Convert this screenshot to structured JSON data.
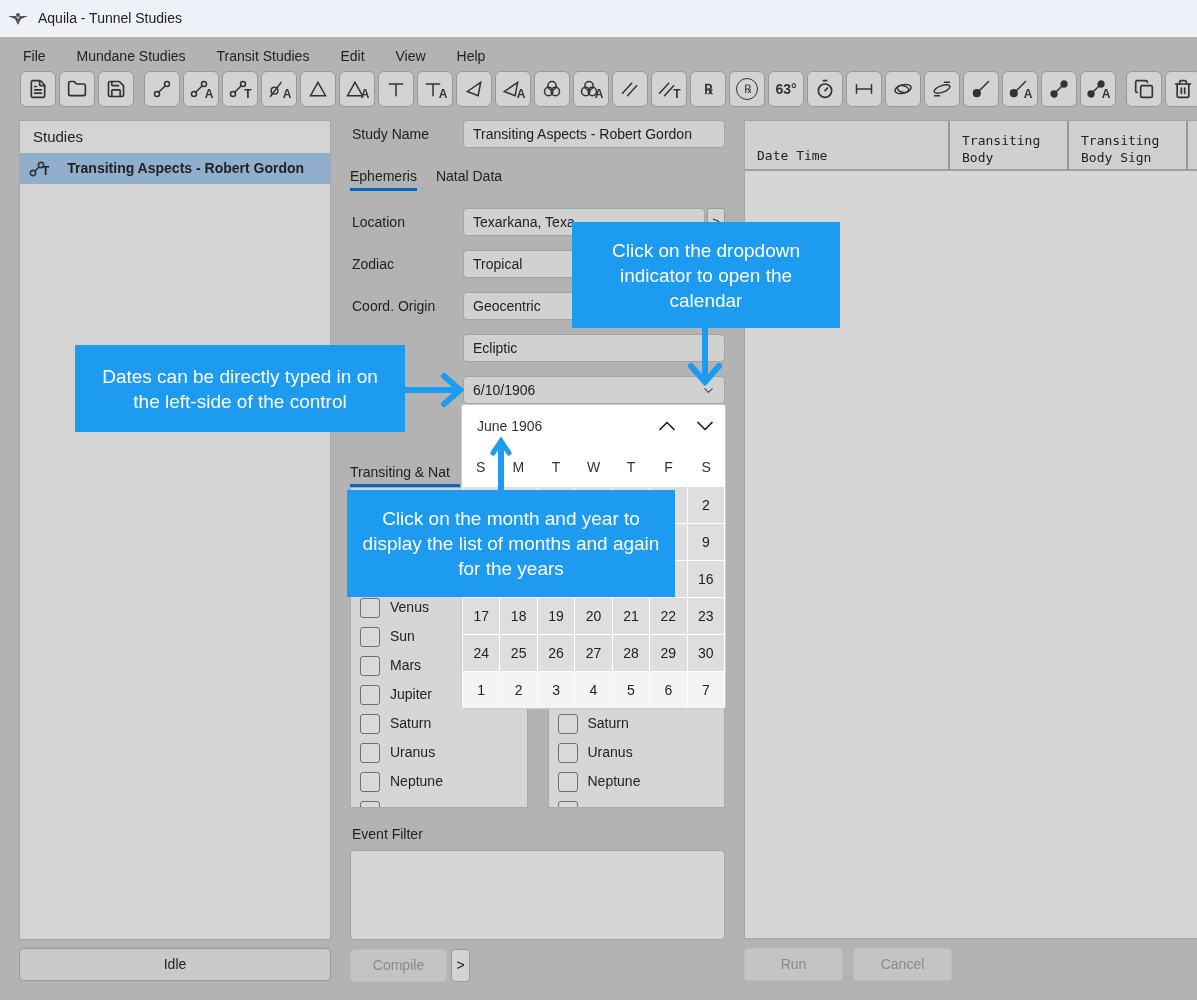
{
  "window": {
    "title": "Aquila - Tunnel Studies"
  },
  "menu": [
    "File",
    "Mundane Studies",
    "Transit Studies",
    "Edit",
    "View",
    "Help"
  ],
  "toolbar": [
    {
      "kind": "document"
    },
    {
      "kind": "folder"
    },
    {
      "kind": "save"
    },
    {
      "kind": "link"
    },
    {
      "kind": "link",
      "letter": "A"
    },
    {
      "kind": "link",
      "letter": "T"
    },
    {
      "kind": "slashed",
      "letter": "A"
    },
    {
      "kind": "triangle"
    },
    {
      "kind": "triangle",
      "letter": "A"
    },
    {
      "kind": "tee"
    },
    {
      "kind": "tee",
      "letter": "A"
    },
    {
      "kind": "angle"
    },
    {
      "kind": "angle",
      "letter": "A"
    },
    {
      "kind": "venn"
    },
    {
      "kind": "venn",
      "letter": "A"
    },
    {
      "kind": "parallel"
    },
    {
      "kind": "parallel",
      "letter": "T"
    },
    {
      "kind": "glyph",
      "text": "℞"
    },
    {
      "kind": "circled",
      "text": "℞"
    },
    {
      "kind": "glyph",
      "text": "63°"
    },
    {
      "kind": "timer"
    },
    {
      "kind": "span"
    },
    {
      "kind": "orbit"
    },
    {
      "kind": "ellipse"
    },
    {
      "kind": "dotline"
    },
    {
      "kind": "dotline",
      "letter": "A"
    },
    {
      "kind": "dumbbell"
    },
    {
      "kind": "dumbbell",
      "letter": "A"
    },
    {
      "kind": "copy"
    },
    {
      "kind": "trash"
    }
  ],
  "sidebar": {
    "title": "Studies",
    "items": [
      {
        "label": "Transiting Aspects - Robert Gordon",
        "icon_letter": "T",
        "selected": true
      }
    ]
  },
  "status": {
    "label": "Idle"
  },
  "form": {
    "study_name": {
      "label": "Study Name",
      "value": "Transiting Aspects - Robert Gordon"
    },
    "tabs": [
      {
        "label": "Ephemeris",
        "selected": true
      },
      {
        "label": "Natal Data",
        "selected": false
      }
    ],
    "fields": [
      {
        "label": "Location",
        "value": "Texarkana, Texa",
        "kind": "combo",
        "side_button": ">"
      },
      {
        "label": "Zodiac",
        "value": "Tropical",
        "kind": "select"
      },
      {
        "label": "Coord. Origin",
        "value": "Geocentric",
        "kind": "select"
      },
      {
        "value": "Ecliptic",
        "kind": "select"
      },
      {
        "value": "6/10/1906",
        "kind": "date"
      }
    ],
    "subtab": {
      "label": "Transiting & Nat",
      "selected": true
    },
    "transiting": [
      {
        "label": "Venus",
        "checked": false
      },
      {
        "label": "Sun",
        "checked": false
      },
      {
        "label": "Mars",
        "checked": false
      },
      {
        "label": "Jupiter",
        "checked": false
      },
      {
        "label": "Saturn",
        "checked": false
      },
      {
        "label": "Uranus",
        "checked": false
      },
      {
        "label": "Neptune",
        "checked": false
      },
      {
        "checked": false
      }
    ],
    "natal": [
      {
        "label": "Saturn",
        "checked": false
      },
      {
        "label": "Uranus",
        "checked": false
      },
      {
        "label": "Neptune",
        "checked": false
      },
      {
        "checked": false
      }
    ],
    "event_filter": {
      "label": "Event Filter"
    },
    "compile": {
      "label": "Compile",
      "disabled": true
    },
    "compile_more": {
      "label": ">",
      "disabled": false
    }
  },
  "calendar": {
    "month": "June 1906",
    "weekdays": [
      "S",
      "M",
      "T",
      "W",
      "T",
      "F",
      "S"
    ],
    "weeks": [
      {
        "outside": false,
        "days": [
          "2"
        ]
      },
      {
        "outside": false,
        "days": [
          "9"
        ]
      },
      {
        "outside": false,
        "days": [
          "16"
        ]
      },
      {
        "outside": false,
        "days": [
          "17",
          "18",
          "19",
          "20",
          "21",
          "22",
          "23"
        ]
      },
      {
        "outside": false,
        "days": [
          "24",
          "25",
          "26",
          "27",
          "28",
          "29",
          "30"
        ]
      },
      {
        "outside": true,
        "days": [
          "1",
          "2",
          "3",
          "4",
          "5",
          "6",
          "7"
        ]
      }
    ]
  },
  "table": {
    "columns": [
      "Date Time",
      "Transiting Body",
      "Transiting Body Sign"
    ]
  },
  "actions": [
    {
      "label": "Run",
      "disabled": true
    },
    {
      "label": "Cancel",
      "disabled": true
    }
  ],
  "callouts": [
    {
      "text": "Dates can be directly typed in on the left-side of the control",
      "kind": "right"
    },
    {
      "text": "Click on the dropdown indicator to open the calendar",
      "kind": "down"
    },
    {
      "text": "Click on the month and year to display the list of months and again for the years",
      "kind": "up"
    }
  ]
}
